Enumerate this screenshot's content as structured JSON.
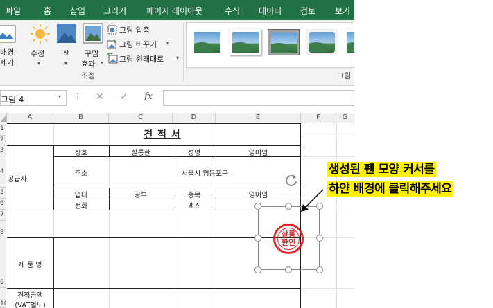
{
  "menubar": {
    "items": [
      "파일",
      "홈",
      "삽입",
      "그리기",
      "페이지 레이아웃",
      "수식",
      "데이터",
      "검토",
      "보기"
    ]
  },
  "ribbon": {
    "remove_bg": {
      "line1": "배경",
      "line2": "제거"
    },
    "corrections": "수정",
    "color": "색",
    "artistic": {
      "line1": "꾸밈",
      "line2": "효과"
    },
    "compress": "그림 압축",
    "change": "그림 바꾸기",
    "reset": "그림 원래대로",
    "adjust_group_label": "조정",
    "styles_group_label": "그림"
  },
  "formula_bar": {
    "name_box": "그림 4",
    "fx": "fx"
  },
  "columns": [
    "A",
    "B",
    "C",
    "D",
    "E",
    "F",
    "G"
  ],
  "rows": [
    "1",
    "2",
    "3",
    "4",
    "5",
    "6",
    "7",
    "8",
    "9",
    "10"
  ],
  "sheet": {
    "title": "견 적 서",
    "supplier_label": "공급자",
    "r3": {
      "label1": "상호",
      "value1": "살롱한",
      "label2": "성명",
      "value2": "영어임"
    },
    "r4": {
      "label": "주소",
      "value": "서울시 영등포구"
    },
    "r5": {
      "label1": "업태",
      "value1": "공부",
      "label2": "종목",
      "value2": "영어임"
    },
    "r6": {
      "label1": "전화",
      "label2": "팩스"
    },
    "product_label": "제 품 명",
    "total_line1": "견적금액",
    "total_line2": "(VAT별도)"
  },
  "stamp": {
    "line1": "살롱",
    "line2": "한인"
  },
  "callout": {
    "line1": "생성된 펜 모양 커서를",
    "line2": "하얀 배경에 클릭해주세요"
  },
  "colors": {
    "excel_green": "#217346",
    "stamp_red": "#e0262b",
    "highlight": "#fff200"
  }
}
